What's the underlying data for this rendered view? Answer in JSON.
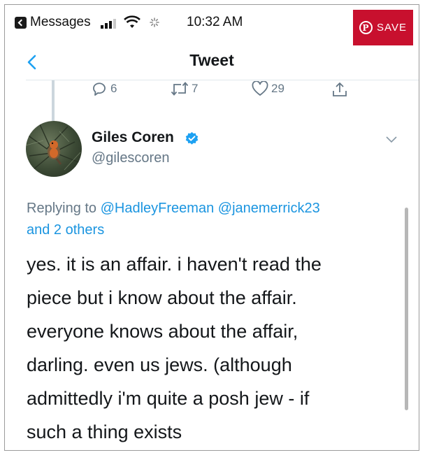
{
  "status_bar": {
    "app_name": "Messages",
    "time": "10:32 AM"
  },
  "pinterest": {
    "save_label": "SAVE",
    "icon": "pinterest-p-icon",
    "color": "#c8102e"
  },
  "nav": {
    "title": "Tweet",
    "back_icon": "chevron-left-icon"
  },
  "actions": {
    "replies": "6",
    "retweets": "7",
    "likes": "29"
  },
  "author": {
    "name": "Giles Coren",
    "handle": "@gilescoren",
    "verified": true
  },
  "reply_context": {
    "prefix": "Replying to",
    "mentions": [
      "@HadleyFreeman",
      "@janemerrick23"
    ],
    "others": "and 2 others"
  },
  "tweet": {
    "lines": [
      "yes. it is an affair. i haven't read the",
      "piece but i know about the affair.",
      "everyone knows about the affair,",
      "darling. even us jews. (although",
      "admittedly i'm quite a posh jew - if",
      "such a thing exists"
    ]
  },
  "colors": {
    "link": "#1b95e0",
    "muted": "#657786",
    "verified": "#1da1f2"
  }
}
